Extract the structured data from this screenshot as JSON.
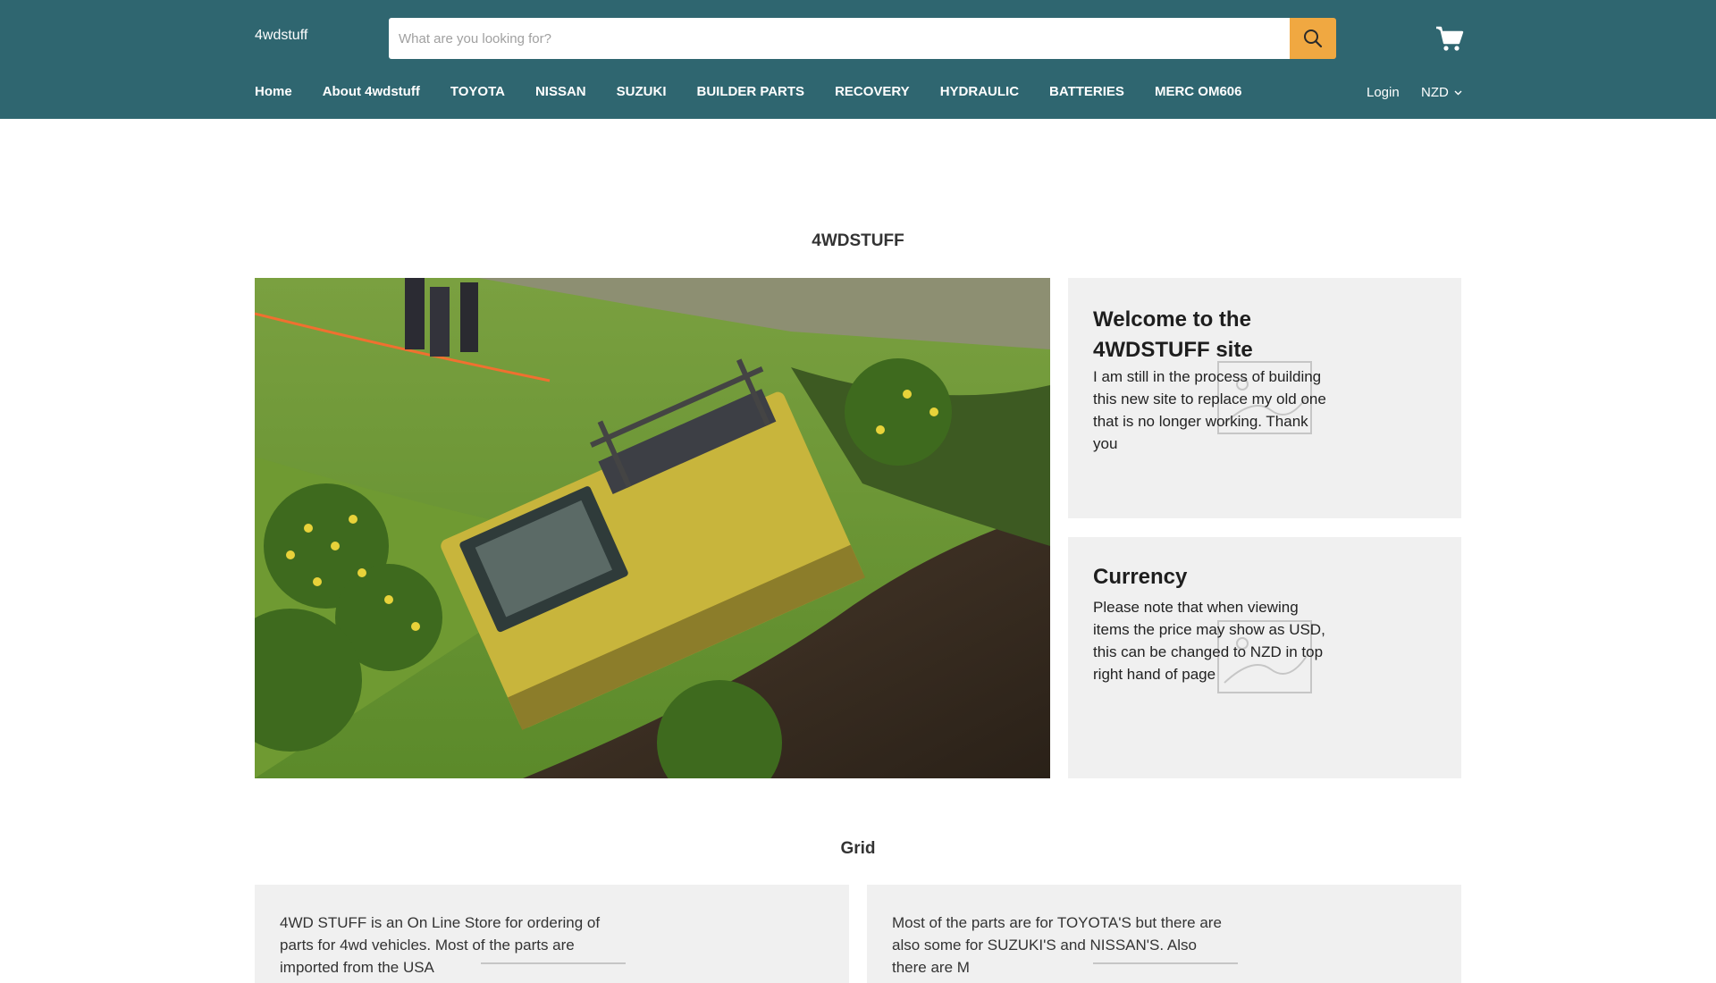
{
  "header": {
    "logo": "4wdstuff",
    "search_placeholder": "What are you looking for?",
    "nav": [
      "Home",
      "About 4wdstuff",
      "TOYOTA",
      "NISSAN",
      "SUZUKI",
      "BUILDER PARTS",
      "RECOVERY",
      "HYDRAULIC",
      "BATTERIES",
      "MERC OM606"
    ],
    "login": "Login",
    "currency": "NZD"
  },
  "main": {
    "title": "4WDSTUFF",
    "welcome": {
      "heading": "Welcome to the 4WDSTUFF site",
      "text": "I am still in the process of building this new site to replace my old one that is no longer working. Thank you"
    },
    "currency_card": {
      "heading": "Currency",
      "text": "Please note that when viewing items the price may show as USD, this can be changed to NZD in top right hand of page"
    }
  },
  "grid": {
    "title": "Grid",
    "items": [
      {
        "text": "4WD STUFF is an On Line Store for ordering of parts for 4wd vehicles. Most of the parts are imported from the USA"
      },
      {
        "text": "Most of the parts are for TOYOTA'S but there are also some for SUZUKI'S and NISSAN'S. Also there are M"
      }
    ]
  },
  "colors": {
    "header_bg": "#2f6670",
    "accent": "#f0a841",
    "card_bg": "#f0f0f0"
  }
}
